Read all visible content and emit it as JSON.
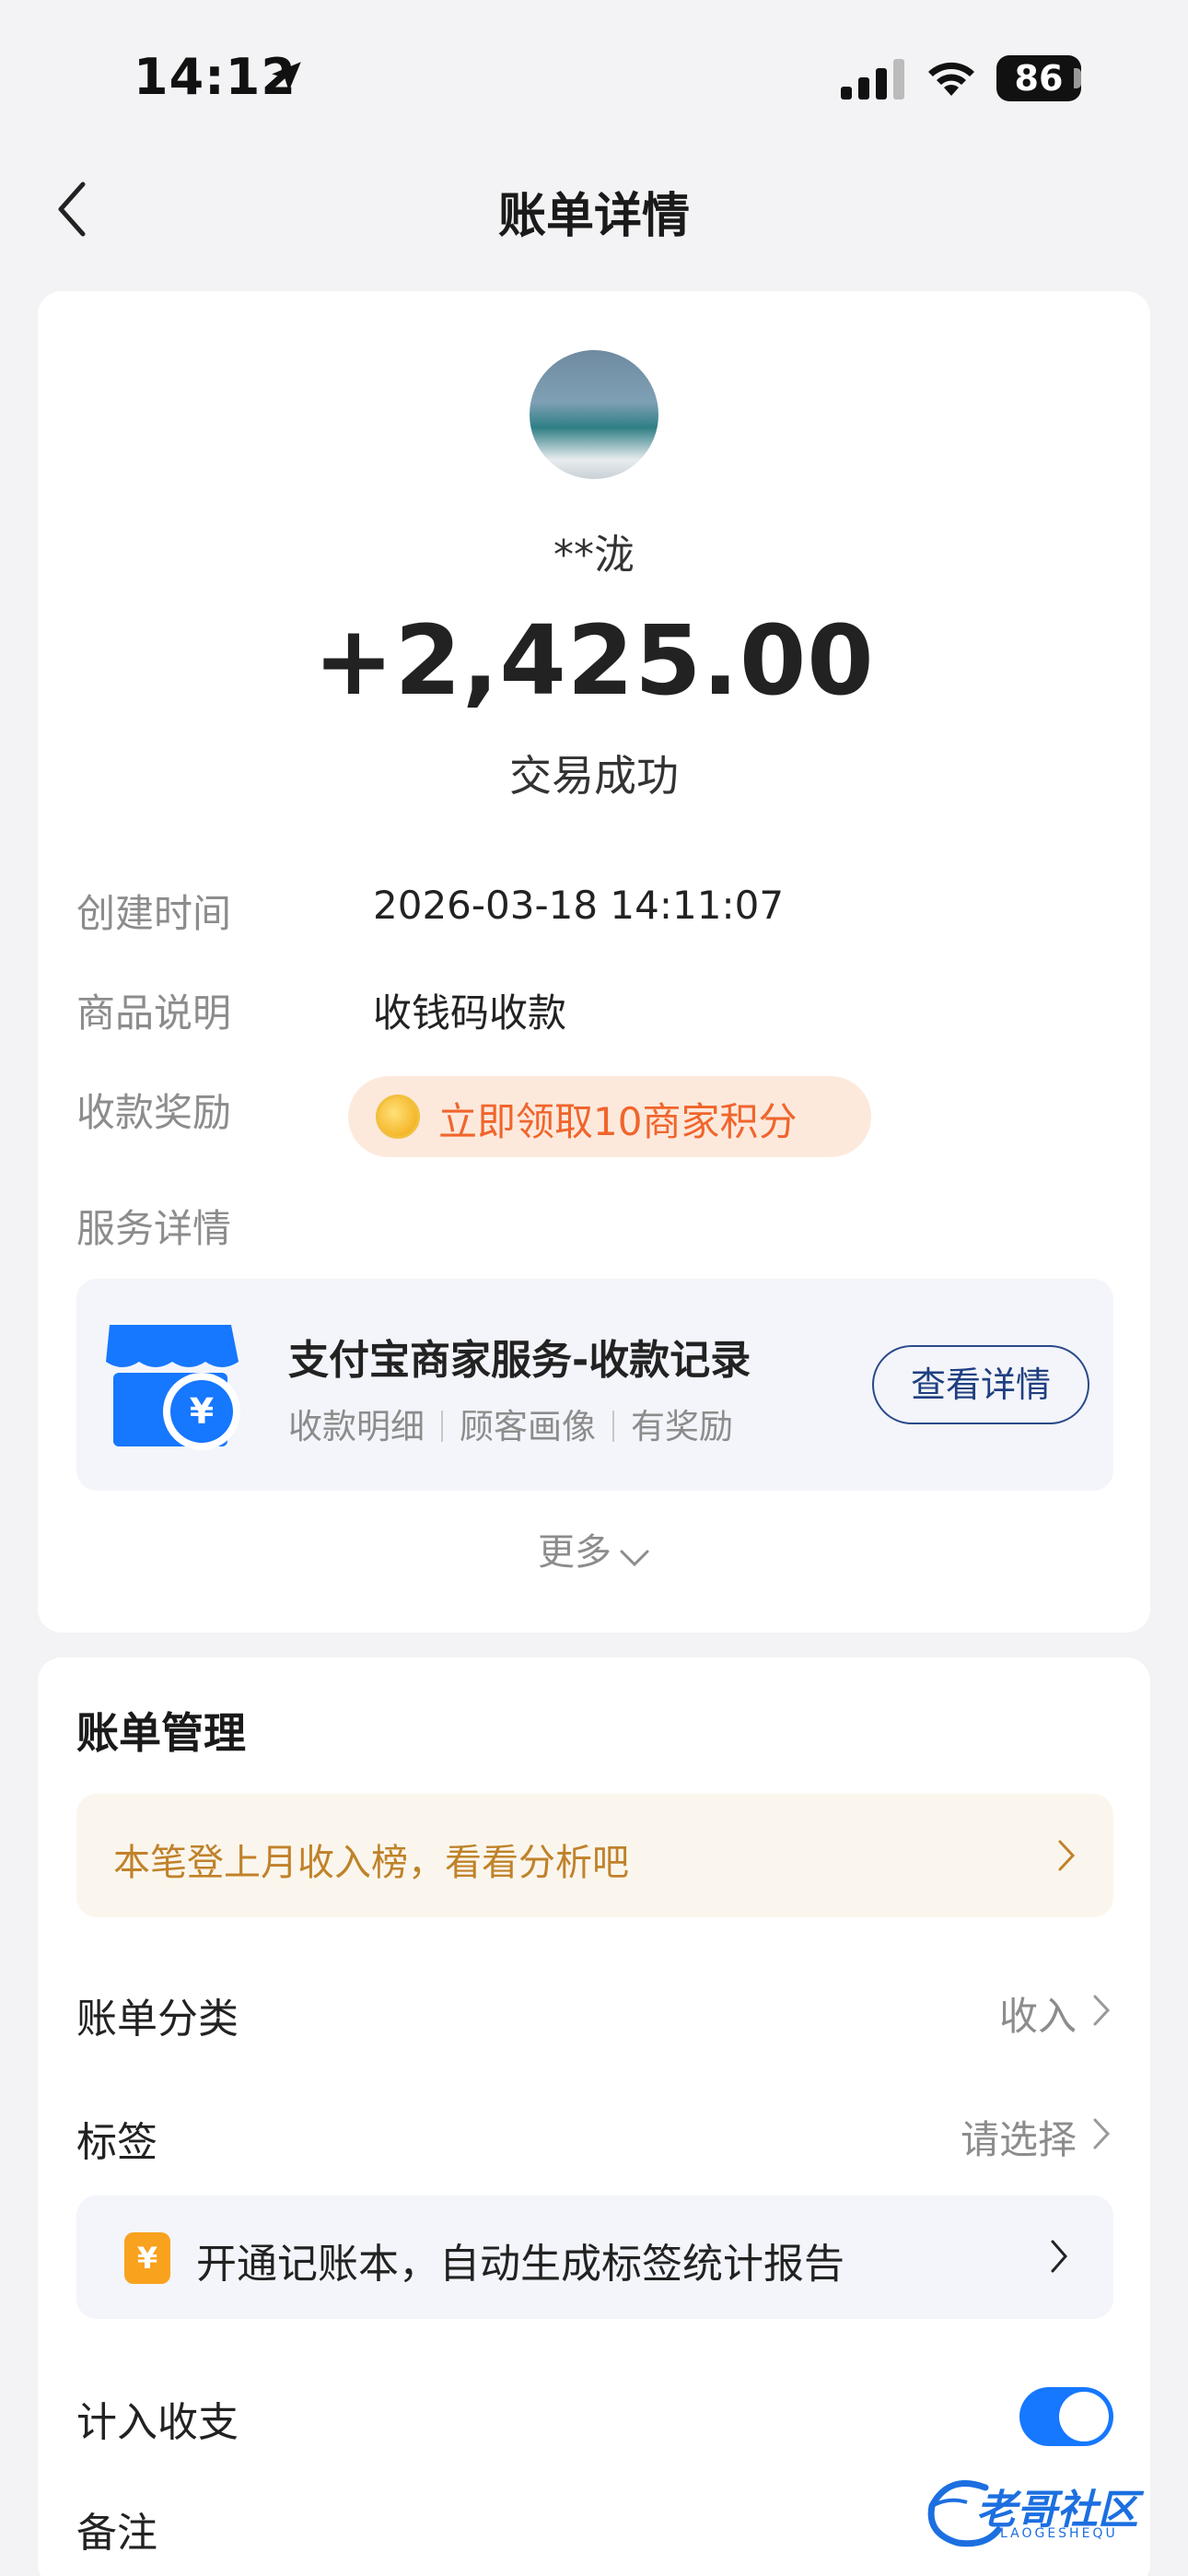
{
  "status_bar": {
    "time": "14:12",
    "battery": "86"
  },
  "nav": {
    "title": "账单详情"
  },
  "transaction": {
    "payer_name": "**泷",
    "amount": "+2,425.00",
    "status": "交易成功"
  },
  "details": [
    {
      "label": "创建时间",
      "value": "2026-03-18 14:11:07"
    },
    {
      "label": "商品说明",
      "value": "收钱码收款"
    },
    {
      "label": "收款奖励",
      "value": "立即领取10商家积分"
    },
    {
      "label": "服务详情",
      "value": ""
    }
  ],
  "service": {
    "title": "支付宝商家服务-收款记录",
    "tags": [
      "收款明细",
      "顾客画像",
      "有奖励"
    ],
    "button": "查看详情",
    "icon": "store-yen-icon"
  },
  "more_label": "更多",
  "management": {
    "title": "账单管理",
    "promo": "本笔登上月收入榜，看看分析吧",
    "rows": [
      {
        "label": "账单分类",
        "value": "收入"
      },
      {
        "label": "标签",
        "value": "请选择"
      }
    ],
    "bookkeeping": "开通记账本，自动生成标签统计报告",
    "include_label": "计入收支",
    "include_on": true,
    "note_label": "备注"
  },
  "watermark": {
    "text": "老哥社区",
    "sub": "LAOGESHEQU"
  },
  "colors": {
    "accent": "#1677ff",
    "reward": "#f0652c",
    "promo": "#c0822a"
  }
}
